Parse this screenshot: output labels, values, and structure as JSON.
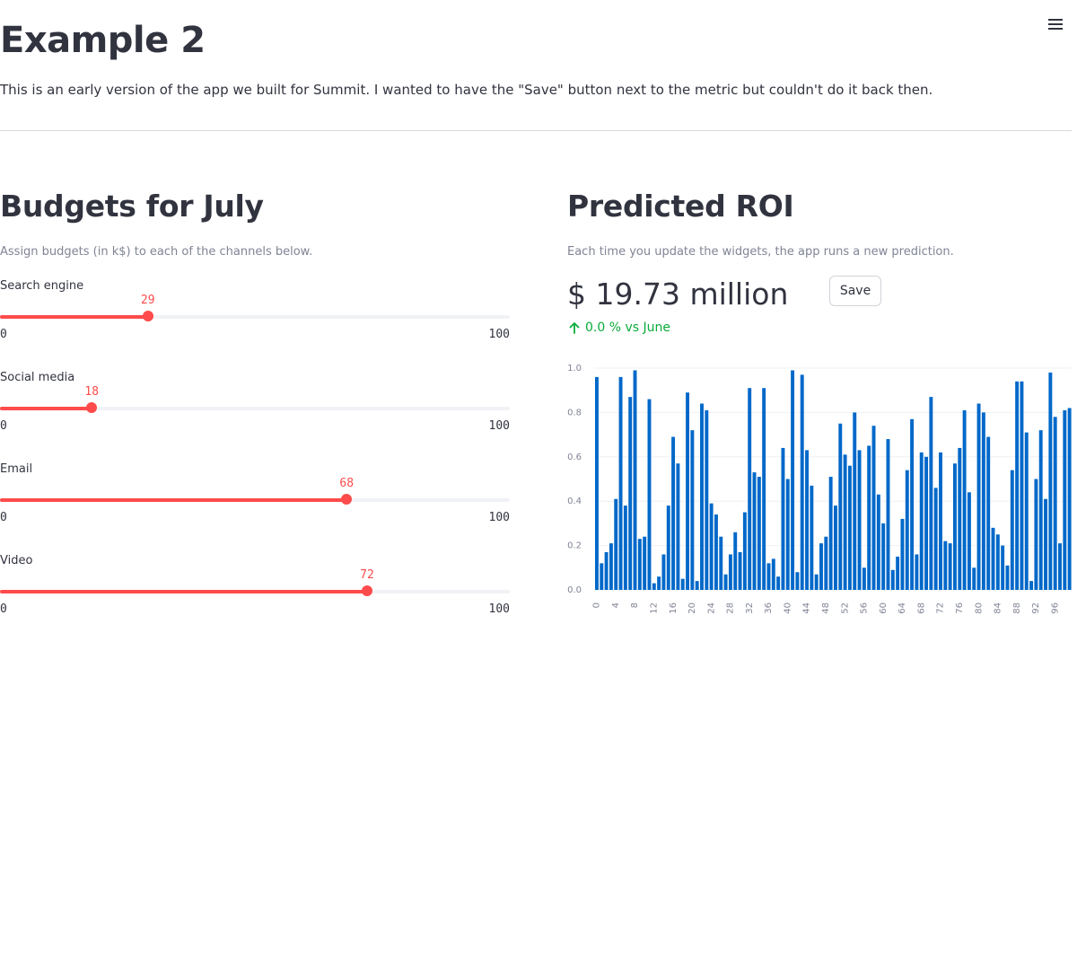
{
  "header": {
    "title": "Example 2",
    "intro": "This is an early version of the app we built for Summit. I wanted to have the \"Save\" button next to the metric but couldn't do it back then.",
    "menu_icon": "hamburger-menu-icon"
  },
  "budgets": {
    "title": "Budgets for July",
    "caption": "Assign budgets (in k$) to each of the channels below.",
    "sliders": [
      {
        "label": "Search engine",
        "value": "29",
        "min": "0",
        "max": "100"
      },
      {
        "label": "Social media",
        "value": "18",
        "min": "0",
        "max": "100"
      },
      {
        "label": "Email",
        "value": "68",
        "min": "0",
        "max": "100"
      },
      {
        "label": "Video",
        "value": "72",
        "min": "0",
        "max": "100"
      }
    ]
  },
  "roi": {
    "title": "Predicted ROI",
    "caption": "Each time you update the widgets, the app runs a new prediction.",
    "metric_value": "$ 19.73 million",
    "metric_delta": "0.0 % vs June",
    "delta_icon": "arrow-up-icon",
    "save_label": "Save"
  },
  "colors": {
    "accent": "#ff4b4b",
    "bar": "#0068c9",
    "positive_delta": "#09ab3b",
    "text": "#31333f",
    "muted": "#808495"
  },
  "chart_data": {
    "type": "bar",
    "x_ticks": [
      "0",
      "4",
      "8",
      "12",
      "16",
      "20",
      "24",
      "28",
      "32",
      "36",
      "40",
      "44",
      "48",
      "52",
      "56",
      "60",
      "64",
      "68",
      "72",
      "76",
      "80",
      "84",
      "88",
      "92",
      "96"
    ],
    "y_ticks": [
      "0.0",
      "0.2",
      "0.4",
      "0.6",
      "0.8",
      "1.0"
    ],
    "ylim": [
      0,
      1.0
    ],
    "x": [
      0,
      1,
      2,
      3,
      4,
      5,
      6,
      7,
      8,
      9,
      10,
      11,
      12,
      13,
      14,
      15,
      16,
      17,
      18,
      19,
      20,
      21,
      22,
      23,
      24,
      25,
      26,
      27,
      28,
      29,
      30,
      31,
      32,
      33,
      34,
      35,
      36,
      37,
      38,
      39,
      40,
      41,
      42,
      43,
      44,
      45,
      46,
      47,
      48,
      49,
      50,
      51,
      52,
      53,
      54,
      55,
      56,
      57,
      58,
      59,
      60,
      61,
      62,
      63,
      64,
      65,
      66,
      67,
      68,
      69,
      70,
      71,
      72,
      73,
      74,
      75,
      76,
      77,
      78,
      79,
      80,
      81,
      82,
      83,
      84,
      85,
      86,
      87,
      88,
      89,
      90,
      91,
      92,
      93,
      94,
      95,
      96,
      97,
      98,
      99
    ],
    "values": [
      0.96,
      0.12,
      0.17,
      0.21,
      0.41,
      0.96,
      0.38,
      0.87,
      0.99,
      0.23,
      0.24,
      0.86,
      0.03,
      0.06,
      0.16,
      0.38,
      0.69,
      0.57,
      0.05,
      0.89,
      0.72,
      0.04,
      0.84,
      0.81,
      0.39,
      0.34,
      0.24,
      0.07,
      0.16,
      0.26,
      0.17,
      0.35,
      0.91,
      0.53,
      0.51,
      0.91,
      0.12,
      0.14,
      0.06,
      0.64,
      0.5,
      0.99,
      0.08,
      0.97,
      0.63,
      0.47,
      0.07,
      0.21,
      0.24,
      0.51,
      0.38,
      0.75,
      0.61,
      0.56,
      0.8,
      0.63,
      0.1,
      0.65,
      0.74,
      0.43,
      0.3,
      0.68,
      0.09,
      0.15,
      0.32,
      0.54,
      0.77,
      0.16,
      0.62,
      0.6,
      0.87,
      0.46,
      0.62,
      0.22,
      0.21,
      0.57,
      0.64,
      0.81,
      0.44,
      0.1,
      0.84,
      0.8,
      0.69,
      0.28,
      0.25,
      0.2,
      0.11,
      0.54,
      0.94,
      0.94,
      0.71,
      0.04,
      0.5,
      0.72,
      0.41,
      0.98,
      0.78,
      0.21,
      0.81,
      0.82
    ]
  }
}
